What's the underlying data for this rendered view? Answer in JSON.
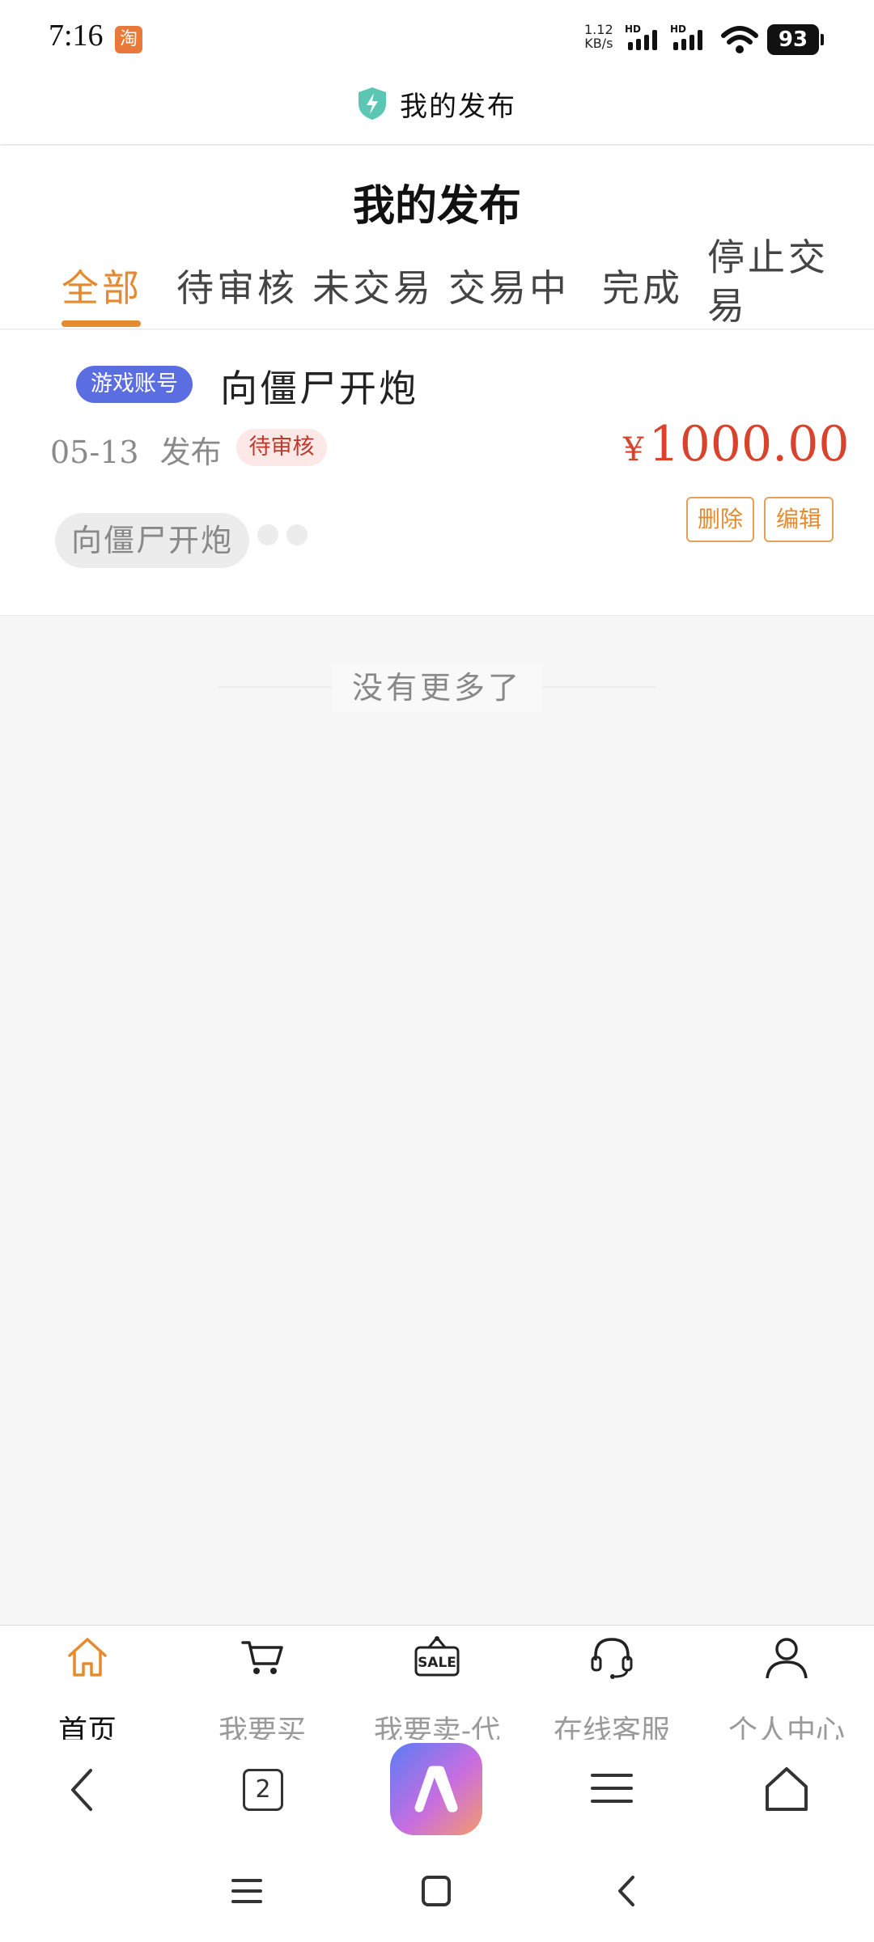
{
  "status_bar": {
    "time": "7:16",
    "taobao_badge": "淘",
    "net_speed_value": "1.12",
    "net_speed_unit": "KB/s",
    "battery": "93"
  },
  "titlebar": {
    "title": "我的发布"
  },
  "page": {
    "title": "我的发布"
  },
  "tabs": [
    {
      "label": "全部",
      "active": true
    },
    {
      "label": "待审核",
      "active": false
    },
    {
      "label": "未交易",
      "active": false
    },
    {
      "label": "交易中",
      "active": false
    },
    {
      "label": "完成",
      "active": false
    },
    {
      "label_line1": "停止交",
      "label_line2": "易",
      "active": false
    }
  ],
  "listing": {
    "category_tag": "游戏账号",
    "title": "向僵尸开炮",
    "date": "05-13",
    "published_label": "发布",
    "status": "待审核",
    "currency": "¥",
    "price": "1000.00",
    "delete_label": "删除",
    "edit_label": "编辑",
    "game_pill": "向僵尸开炮"
  },
  "list_footer": {
    "text": "没有更多了"
  },
  "bottom_nav": [
    {
      "label": "首页",
      "icon": "home-icon",
      "active": true
    },
    {
      "label": "我要买",
      "icon": "cart-icon",
      "active": false
    },
    {
      "label": "我要卖-代",
      "icon": "sale-tag-icon",
      "active": false
    },
    {
      "label": "在线客服",
      "icon": "headset-icon",
      "active": false
    },
    {
      "label": "个人中心",
      "icon": "user-icon",
      "active": false
    }
  ],
  "browser_bar": {
    "tab_count": "2"
  },
  "colors": {
    "accent": "#e58a2f",
    "price": "#d9432b",
    "tag": "#5b6ee1"
  }
}
